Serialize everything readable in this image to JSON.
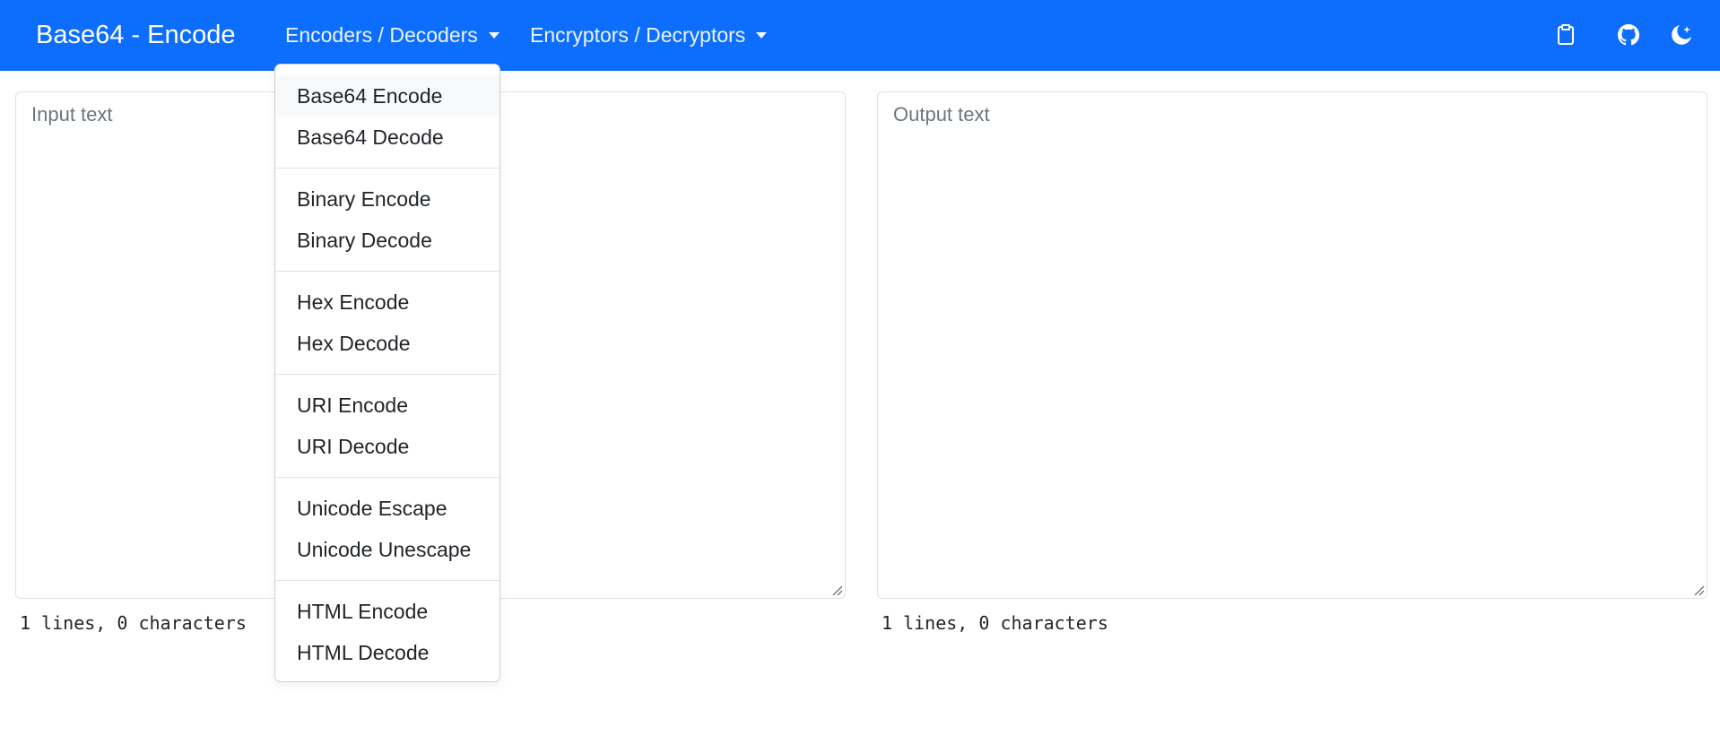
{
  "navbar": {
    "brand": "Base64 - Encode",
    "menu_encoders": "Encoders / Decoders",
    "menu_encryptors": "Encryptors / Decryptors",
    "icons": [
      "clipboard-icon",
      "github-icon",
      "theme-toggle-icon"
    ],
    "color": "#0d6efd"
  },
  "input": {
    "placeholder": "Input text",
    "value": "",
    "stats": "1 lines, 0 characters"
  },
  "output": {
    "placeholder": "Output text",
    "value": "",
    "stats": "1 lines, 0 characters"
  },
  "dropdown": {
    "groups": [
      [
        "Base64 Encode",
        "Base64 Decode"
      ],
      [
        "Binary Encode",
        "Binary Decode"
      ],
      [
        "Hex Encode",
        "Hex Decode"
      ],
      [
        "URI Encode",
        "URI Decode"
      ],
      [
        "Unicode Escape",
        "Unicode Unescape"
      ],
      [
        "HTML Encode",
        "HTML Decode"
      ]
    ],
    "active": "Base64 Encode"
  }
}
